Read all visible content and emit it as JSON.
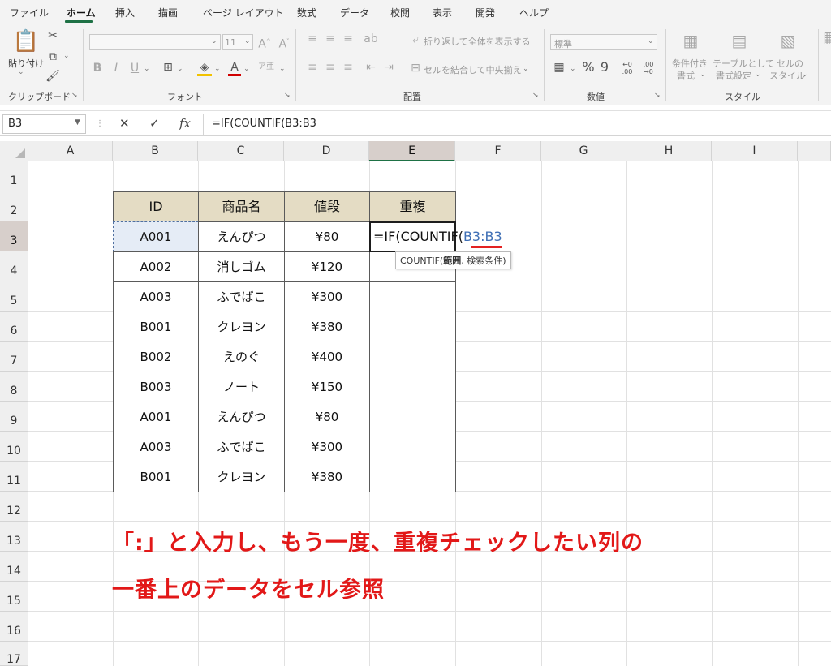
{
  "ribbon_tabs": [
    {
      "label": "ファイル"
    },
    {
      "label": "ホーム"
    },
    {
      "label": "挿入"
    },
    {
      "label": "描画"
    },
    {
      "label": "ページ レイアウト"
    },
    {
      "label": "数式"
    },
    {
      "label": "データ"
    },
    {
      "label": "校閲"
    },
    {
      "label": "表示"
    },
    {
      "label": "開発"
    },
    {
      "label": "ヘルプ"
    }
  ],
  "active_tab": "ホーム",
  "clipboard": {
    "paste_label": "貼り付け",
    "group_label": "クリップボード"
  },
  "font": {
    "size_value": "11",
    "group_label": "フォント",
    "bold": "B",
    "italic": "I",
    "underline": "U",
    "grow": "A^",
    "shrink": "A˅"
  },
  "alignment": {
    "wrap_text": "折り返して全体を表示する",
    "merge_center": "セルを結合して中央揃え",
    "group_label": "配置"
  },
  "number": {
    "format_value": "標準",
    "percent": "%",
    "comma": "9",
    "group_label": "数値"
  },
  "styles": {
    "conditional": "条件付き",
    "conditional_2": "書式",
    "as_table": "テーブルとして",
    "as_table_2": "書式設定",
    "cell_styles": "セルの",
    "cell_styles_2": "スタイル",
    "group_label": "スタイル"
  },
  "formula_bar": {
    "name_box": "B3",
    "cancel": "✕",
    "enter": "✓",
    "fx": "fx",
    "formula": "=IF(COUNTIF(B3:B3"
  },
  "sheet": {
    "columns": [
      "A",
      "B",
      "C",
      "D",
      "E",
      "F",
      "G",
      "H",
      "I"
    ],
    "rows": [
      "1",
      "2",
      "3",
      "4",
      "5",
      "6",
      "7",
      "8",
      "9",
      "10",
      "11",
      "12",
      "13",
      "14",
      "15",
      "16",
      "17"
    ],
    "selected_column": "E",
    "selected_row": "3",
    "table_headers": [
      "ID",
      "商品名",
      "値段",
      "重複"
    ],
    "table_rows": [
      [
        "A001",
        "えんぴつ",
        "¥80"
      ],
      [
        "A002",
        "消しゴム",
        "¥120"
      ],
      [
        "A003",
        "ふでばこ",
        "¥300"
      ],
      [
        "B001",
        "クレヨン",
        "¥380"
      ],
      [
        "B002",
        "えのぐ",
        "¥400"
      ],
      [
        "B003",
        "ノート",
        "¥150"
      ],
      [
        "A001",
        "えんぴつ",
        "¥80"
      ],
      [
        "A003",
        "ふでばこ",
        "¥300"
      ],
      [
        "B001",
        "クレヨン",
        "¥380"
      ]
    ],
    "editing_cell": {
      "prefix": "=IF(COUNTIF(",
      "ref": "B3:B3"
    },
    "tooltip": {
      "func": "COUNTIF(",
      "arg1": "範囲",
      "rest": ", 検索条件)"
    }
  },
  "annotation": {
    "line1": "「:」と入力し、もう一度、重複チェックしたい列の",
    "line2": "一番上のデータをセル参照"
  },
  "colors": {
    "accent": "#1e7145",
    "annotation_red": "#e21818",
    "header_fill": "#e4dcc4",
    "reference_blue": "#3f6fb5"
  }
}
